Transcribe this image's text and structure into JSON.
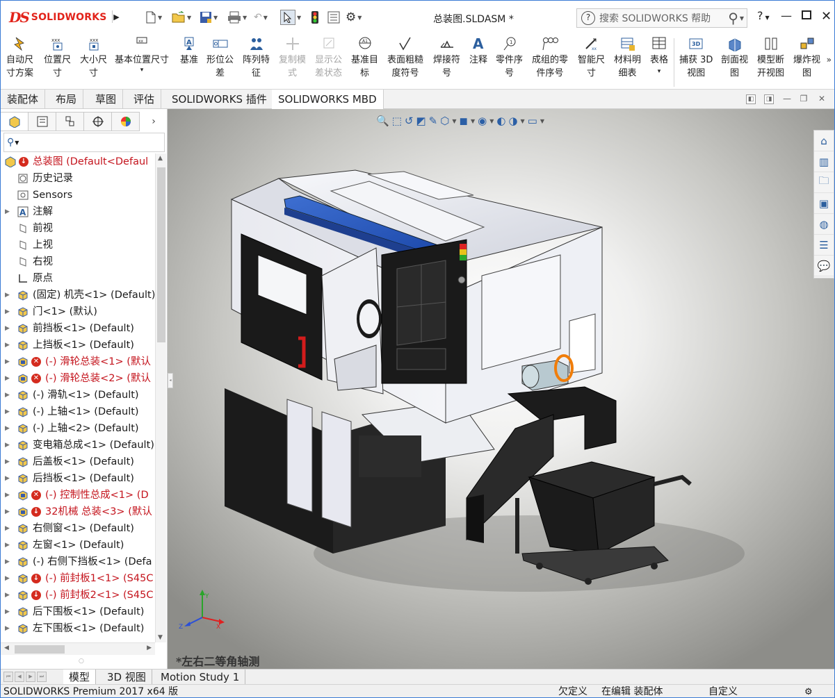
{
  "app": {
    "brand": "SOLIDWORKS",
    "brand_mark": "DS",
    "doc_title": "总装图.SLDASM *"
  },
  "search": {
    "placeholder": "搜索 SOLIDWORKS 帮助"
  },
  "toolbar": {
    "items": [
      {
        "label": "自动尺\n寸方案",
        "icon": "auto-dimension-icon",
        "enabled": true
      },
      {
        "label": "位置尺\n寸",
        "icon": "location-dimension-icon",
        "enabled": true
      },
      {
        "label": "大小尺\n寸",
        "icon": "size-dimension-icon",
        "enabled": true
      },
      {
        "label": "基本位置尺寸",
        "icon": "basic-location-dimension-icon",
        "enabled": true
      },
      {
        "label": "基准",
        "icon": "datum-icon",
        "enabled": true
      },
      {
        "label": "形位公\n差",
        "icon": "geometric-tolerance-icon",
        "enabled": true
      },
      {
        "label": "阵列特\n征",
        "icon": "pattern-feature-icon",
        "enabled": true
      },
      {
        "label": "复制模\n式",
        "icon": "copy-scheme-icon",
        "enabled": false
      },
      {
        "label": "显示公\n差状态",
        "icon": "tolerance-status-icon",
        "enabled": false
      },
      {
        "label": "基准目\n标",
        "icon": "datum-target-icon",
        "enabled": true
      },
      {
        "label": "表面粗糙\n度符号",
        "icon": "surface-finish-icon",
        "enabled": true
      },
      {
        "label": "焊接符\n号",
        "icon": "weld-symbol-icon",
        "enabled": true
      },
      {
        "label": "注释",
        "icon": "note-icon",
        "enabled": true
      },
      {
        "label": "零件序\n号",
        "icon": "balloon-icon",
        "enabled": true
      },
      {
        "label": "成组的零\n件序号",
        "icon": "stacked-balloon-icon",
        "enabled": true
      },
      {
        "label": "智能尺\n寸",
        "icon": "smart-dimension-icon",
        "enabled": true
      },
      {
        "label": "材料明\n细表",
        "icon": "bom-icon",
        "enabled": true
      },
      {
        "label": "表格",
        "icon": "table-icon",
        "enabled": true
      },
      {
        "label": "捕获 3D\n视图",
        "icon": "capture-3d-view-icon",
        "enabled": true
      },
      {
        "label": "剖面视\n图",
        "icon": "section-view-icon",
        "enabled": true
      },
      {
        "label": "模型断\n开视图",
        "icon": "model-break-view-icon",
        "enabled": true
      },
      {
        "label": "爆炸视\n图",
        "icon": "exploded-view-icon",
        "enabled": true
      }
    ]
  },
  "tabs": [
    "装配体",
    "布局",
    "草图",
    "评估",
    "SOLIDWORKS 插件",
    "SOLIDWORKS MBD"
  ],
  "active_tab": "SOLIDWORKS MBD",
  "tree": [
    {
      "label": "总装图  (Default<Defaul",
      "icon": "assembly-icon",
      "red": true,
      "warn": true,
      "expand": false,
      "indent": 0
    },
    {
      "label": "历史记录",
      "icon": "history-icon",
      "indent": 1
    },
    {
      "label": "Sensors",
      "icon": "sensor-icon",
      "indent": 1
    },
    {
      "label": "注解",
      "icon": "annotations-icon",
      "indent": 1,
      "expand": true
    },
    {
      "label": "前视",
      "icon": "plane-icon",
      "indent": 1
    },
    {
      "label": "上视",
      "icon": "plane-icon",
      "indent": 1
    },
    {
      "label": "右视",
      "icon": "plane-icon",
      "indent": 1
    },
    {
      "label": "原点",
      "icon": "origin-icon",
      "indent": 1
    },
    {
      "label": "(固定) 机壳<1> (Default)",
      "icon": "part-icon",
      "indent": 1,
      "expand": true
    },
    {
      "label": "门<1> (默认)",
      "icon": "part-icon",
      "indent": 1,
      "expand": true
    },
    {
      "label": "前挡板<1> (Default)",
      "icon": "part-icon",
      "indent": 1,
      "expand": true
    },
    {
      "label": "上挡板<1> (Default)",
      "icon": "part-icon",
      "indent": 1,
      "expand": true
    },
    {
      "label": "(-) 滑轮总装<1> (默认",
      "icon": "subassembly-icon",
      "red": true,
      "err": true,
      "indent": 1,
      "expand": true
    },
    {
      "label": "(-) 滑轮总装<2> (默认",
      "icon": "subassembly-icon",
      "red": true,
      "err": true,
      "indent": 1,
      "expand": true
    },
    {
      "label": "(-) 滑轨<1> (Default)",
      "icon": "part-icon",
      "indent": 1,
      "expand": true
    },
    {
      "label": "(-) 上轴<1> (Default)",
      "icon": "part-icon",
      "indent": 1,
      "expand": true
    },
    {
      "label": "(-) 上轴<2> (Default)",
      "icon": "part-icon",
      "indent": 1,
      "expand": true
    },
    {
      "label": "变电箱总成<1> (Default)",
      "icon": "part-icon",
      "indent": 1,
      "expand": true
    },
    {
      "label": "后盖板<1> (Default)",
      "icon": "part-icon",
      "indent": 1,
      "expand": true
    },
    {
      "label": "后挡板<1> (Default)",
      "icon": "part-icon",
      "indent": 1,
      "expand": true
    },
    {
      "label": "(-) 控制性总成<1> (D",
      "icon": "subassembly-icon",
      "red": true,
      "err": true,
      "indent": 1,
      "expand": true
    },
    {
      "label": "32机械 总装<3> (默认",
      "icon": "subassembly-icon",
      "red": true,
      "warn": true,
      "indent": 1,
      "expand": true
    },
    {
      "label": "右侧窗<1> (Default)",
      "icon": "part-icon",
      "indent": 1,
      "expand": true
    },
    {
      "label": "左窗<1> (Default)",
      "icon": "part-icon",
      "indent": 1,
      "expand": true
    },
    {
      "label": "(-) 右侧下挡板<1> (Defa",
      "icon": "part-icon",
      "indent": 1,
      "expand": true
    },
    {
      "label": "(-) 前封板1<1> (S45C",
      "icon": "part-icon",
      "red": true,
      "warn": true,
      "indent": 1,
      "expand": true
    },
    {
      "label": "(-) 前封板2<1> (S45C",
      "icon": "part-icon",
      "red": true,
      "warn": true,
      "indent": 1,
      "expand": true
    },
    {
      "label": "后下围板<1> (Default)",
      "icon": "part-icon",
      "indent": 1,
      "expand": true
    },
    {
      "label": "左下围板<1> (Default)",
      "icon": "part-icon",
      "indent": 1,
      "expand": true
    }
  ],
  "view": {
    "orientation_label": "*左右二等角轴测"
  },
  "bottom_tabs": [
    "模型",
    "3D 视图",
    "Motion Study 1"
  ],
  "active_bottom_tab": "模型",
  "status": {
    "product": "SOLIDWORKS Premium 2017 x64 版",
    "definition": "欠定义",
    "mode": "在编辑 装配体",
    "custom": "自定义"
  },
  "colors": {
    "brand": "#e2231a",
    "error": "#d42b1e",
    "tree_red": "#c4141d",
    "accent": "#2c5f9e"
  }
}
